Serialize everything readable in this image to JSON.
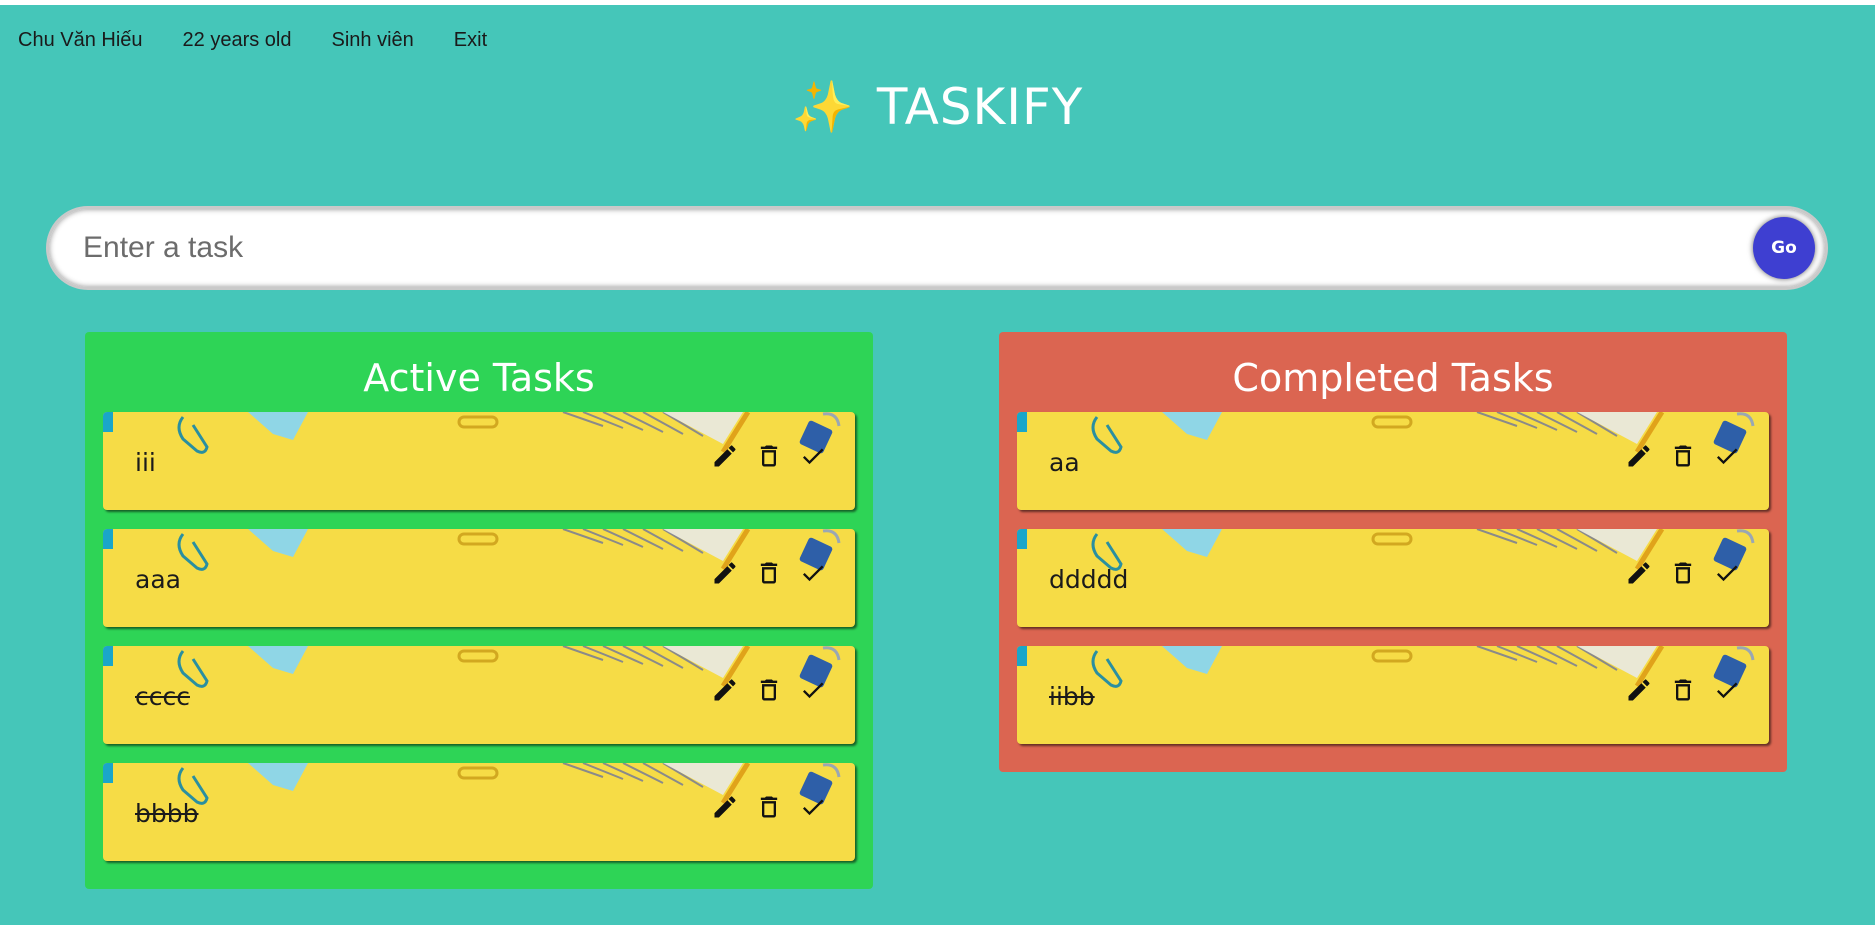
{
  "nav": {
    "name": "Chu Văn Hiếu",
    "age": "22 years old",
    "role": "Sinh viên",
    "exit": "Exit"
  },
  "header": {
    "sparkle": "✨",
    "title": "TASKIFY"
  },
  "search": {
    "placeholder": "Enter a task",
    "value": "",
    "button_label": "Go"
  },
  "active": {
    "title": "Active Tasks",
    "tasks": [
      {
        "text": "iii",
        "struck": false
      },
      {
        "text": "aaa",
        "struck": false
      },
      {
        "text": "cccc",
        "struck": true
      },
      {
        "text": "bbbb",
        "struck": true
      }
    ]
  },
  "completed": {
    "title": "Completed Tasks",
    "tasks": [
      {
        "text": "aa",
        "struck": false
      },
      {
        "text": "ddddd",
        "struck": false
      },
      {
        "text": "iibb",
        "struck": true
      }
    ]
  },
  "colors": {
    "background": "#45c6b9",
    "active_panel": "#2ed456",
    "completed_panel": "#db6551",
    "card": "#f6dc46",
    "go_button": "#3e3fd1"
  },
  "icons": [
    "edit-icon",
    "delete-icon",
    "check-icon",
    "sparkle-icon"
  ]
}
